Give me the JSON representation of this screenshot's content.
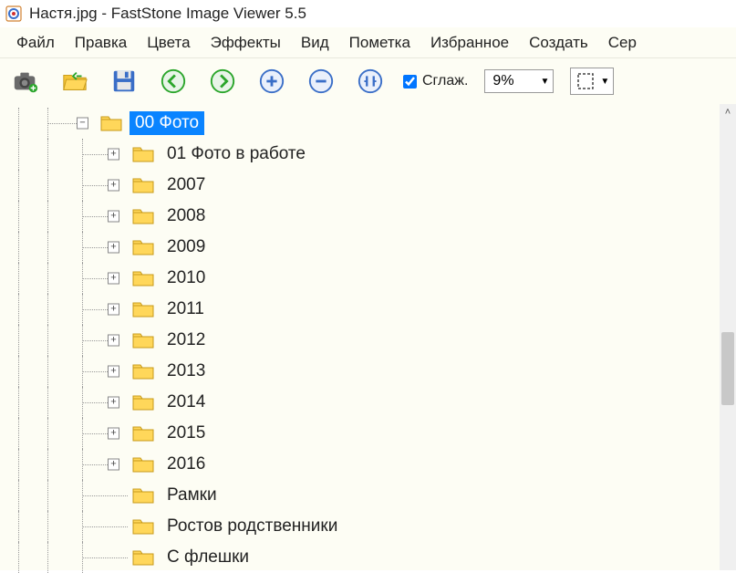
{
  "title": "Настя.jpg  -  FastStone Image Viewer 5.5",
  "menu": [
    "Файл",
    "Правка",
    "Цвета",
    "Эффекты",
    "Вид",
    "Пометка",
    "Избранное",
    "Создать",
    "Сер"
  ],
  "toolbar": {
    "smoothing_label": "Сглаж.",
    "zoom": "9%"
  },
  "tree": {
    "root": {
      "label": "00 Фото",
      "expanded": true,
      "selected": true
    },
    "children": [
      {
        "label": "01 Фото в работе",
        "expandable": true
      },
      {
        "label": "2007",
        "expandable": true
      },
      {
        "label": "2008",
        "expandable": true
      },
      {
        "label": "2009",
        "expandable": true
      },
      {
        "label": "2010",
        "expandable": true
      },
      {
        "label": "2011",
        "expandable": true
      },
      {
        "label": "2012",
        "expandable": true
      },
      {
        "label": "2013",
        "expandable": true
      },
      {
        "label": "2014",
        "expandable": true
      },
      {
        "label": "2015",
        "expandable": true
      },
      {
        "label": "2016",
        "expandable": true
      },
      {
        "label": "Рамки",
        "expandable": false
      },
      {
        "label": "Ростов родственники",
        "expandable": false
      },
      {
        "label": "С флешки",
        "expandable": false
      }
    ]
  }
}
